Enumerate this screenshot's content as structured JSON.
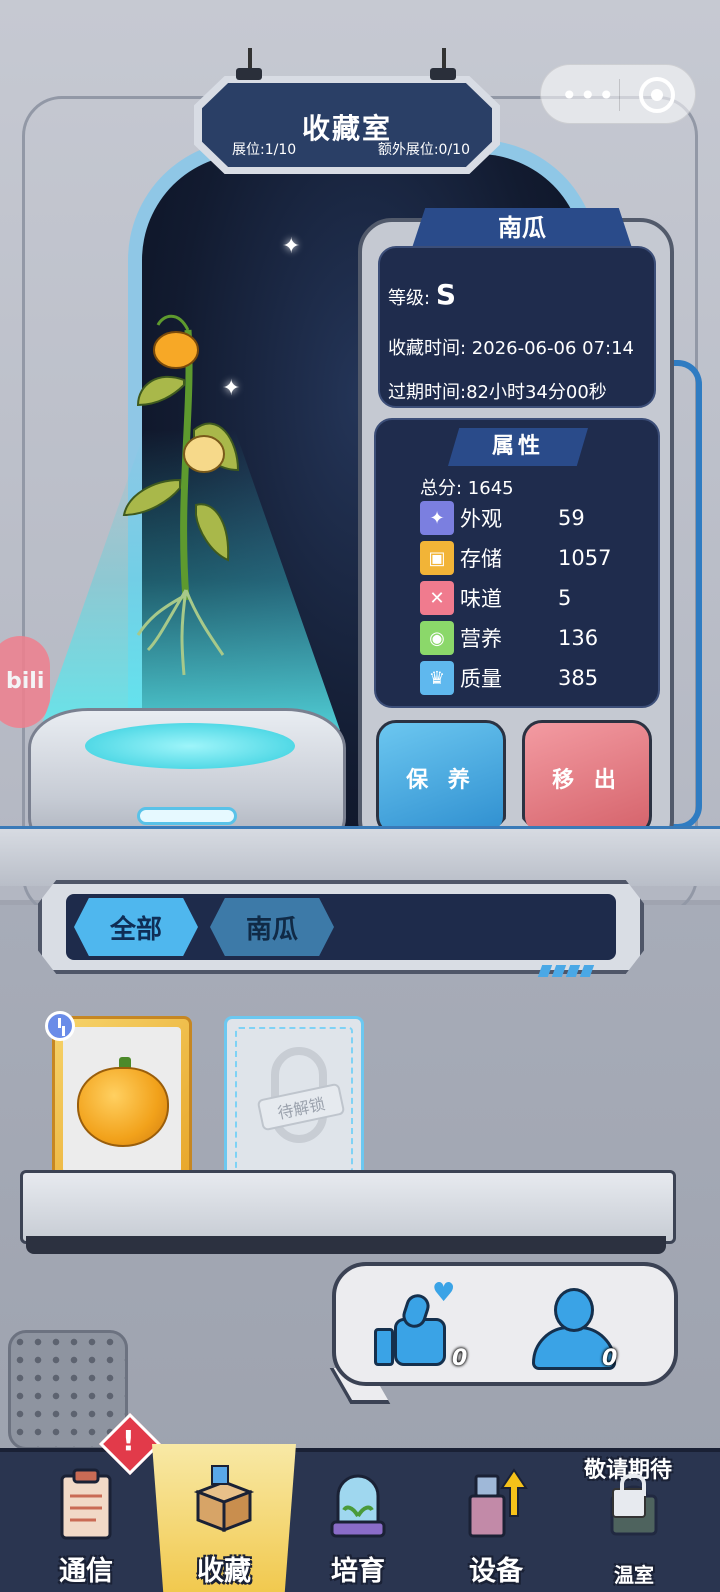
{
  "header": {
    "title": "收藏室",
    "slots_label": "展位:1/10",
    "extra_slots_label": "额外展位:0/10"
  },
  "capsule": {
    "more_icon": "more-dots-icon",
    "close_icon": "target-icon"
  },
  "side_badge": "bili",
  "plant_info": {
    "name": "南瓜",
    "grade_label": "等级:",
    "grade_value": "S",
    "collect_time": "收藏时间: 2026-06-06 07:14",
    "expire_time": "过期时间:82小时34分00秒"
  },
  "attributes": {
    "title": "属性",
    "total": "总分: 1645",
    "items": [
      {
        "label": "外观",
        "value": "59",
        "icon": "sparkle-icon",
        "color": "#7b7fe0"
      },
      {
        "label": "存储",
        "value": "1057",
        "icon": "box-icon",
        "color": "#f2b437"
      },
      {
        "label": "味道",
        "value": "5",
        "icon": "utensils-icon",
        "color": "#f07b8e"
      },
      {
        "label": "营养",
        "value": "136",
        "icon": "lime-icon",
        "color": "#8bd86a"
      },
      {
        "label": "质量",
        "value": "385",
        "icon": "muscle-icon",
        "color": "#5fb8ee"
      }
    ]
  },
  "actions": {
    "keep": "保 养",
    "remove": "移 出"
  },
  "filter": {
    "all": "全部",
    "pumpkin": "南瓜"
  },
  "cards": {
    "locked_text": "待解锁"
  },
  "social": {
    "likes": "0",
    "visitors": "0"
  },
  "nav": {
    "items": [
      {
        "label": "通信"
      },
      {
        "label": "收藏"
      },
      {
        "label": "培育"
      },
      {
        "label": "设备"
      },
      {
        "label": "温室"
      }
    ],
    "alert": "!",
    "coming_soon": "敬请期待"
  }
}
